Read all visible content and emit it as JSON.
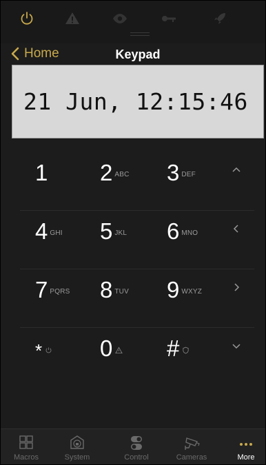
{
  "nav": {
    "back_label": "Home",
    "title": "Keypad"
  },
  "display": {
    "text": "21 Jun, 12:15:46"
  },
  "keypad": {
    "rows": [
      [
        {
          "digit": "1",
          "sub": ""
        },
        {
          "digit": "2",
          "sub": "ABC"
        },
        {
          "digit": "3",
          "sub": "DEF"
        }
      ],
      [
        {
          "digit": "4",
          "sub": "GHI"
        },
        {
          "digit": "5",
          "sub": "JKL"
        },
        {
          "digit": "6",
          "sub": "MNO"
        }
      ],
      [
        {
          "digit": "7",
          "sub": "PQRS"
        },
        {
          "digit": "8",
          "sub": "TUV"
        },
        {
          "digit": "9",
          "sub": "WXYZ"
        }
      ],
      [
        {
          "digit": "*",
          "sub": "",
          "icon": "power-icon"
        },
        {
          "digit": "0",
          "sub": "",
          "icon": "warning-icon"
        },
        {
          "digit": "#",
          "sub": "",
          "icon": "shield-icon"
        }
      ]
    ],
    "arrows": [
      "chevron-up-icon",
      "chevron-left-icon",
      "chevron-right-icon",
      "chevron-down-icon"
    ]
  },
  "status_icons": [
    "power-icon",
    "warning-icon",
    "eye-icon",
    "key-icon",
    "rocket-icon"
  ],
  "tabs": [
    {
      "label": "Macros",
      "icon": "grid-icon",
      "active": false
    },
    {
      "label": "System",
      "icon": "house-lock-icon",
      "active": false
    },
    {
      "label": "Control",
      "icon": "toggle-icon",
      "active": false
    },
    {
      "label": "Cameras",
      "icon": "camera-icon",
      "active": false
    },
    {
      "label": "More",
      "icon": "more-dots-icon",
      "active": true
    }
  ],
  "colors": {
    "accent": "#c8a94c",
    "power_on": "#c8a94c",
    "inactive": "#3a3a3a"
  }
}
